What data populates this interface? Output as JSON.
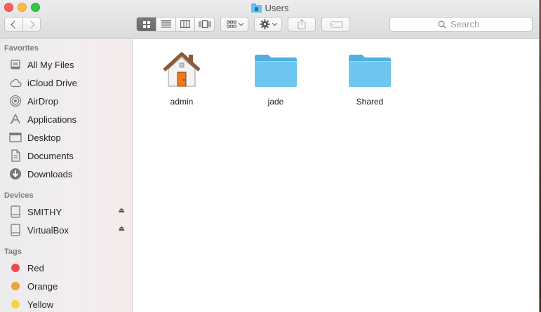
{
  "window": {
    "title": "Users",
    "title_icon": "users-folder-icon"
  },
  "toolbar": {
    "back_icon": "chevron-left-icon",
    "forward_icon": "chevron-right-icon",
    "view_modes": [
      "icon-view",
      "list-view",
      "column-view",
      "cover-flow-view"
    ],
    "active_view": "icon-view",
    "arrange_icon": "arrange-grid-icon",
    "action_icon": "gear-icon",
    "share_icon": "share-icon",
    "tag_icon": "tag-icon",
    "search_placeholder": "Search"
  },
  "sidebar": {
    "favorites": {
      "header": "Favorites",
      "items": [
        {
          "label": "All My Files",
          "icon": "all-files-icon"
        },
        {
          "label": "iCloud Drive",
          "icon": "cloud-icon"
        },
        {
          "label": "AirDrop",
          "icon": "airdrop-icon"
        },
        {
          "label": "Applications",
          "icon": "applications-icon"
        },
        {
          "label": "Desktop",
          "icon": "desktop-icon"
        },
        {
          "label": "Documents",
          "icon": "documents-icon"
        },
        {
          "label": "Downloads",
          "icon": "downloads-icon"
        }
      ]
    },
    "devices": {
      "header": "Devices",
      "items": [
        {
          "label": "SMITHY",
          "icon": "disk-icon",
          "ejectable": true
        },
        {
          "label": "VirtualBox",
          "icon": "disk-icon",
          "ejectable": true
        }
      ]
    },
    "tags": {
      "header": "Tags",
      "items": [
        {
          "label": "Red",
          "color": "#f2484d"
        },
        {
          "label": "Orange",
          "color": "#f3a03c"
        },
        {
          "label": "Yellow",
          "color": "#f5d349"
        }
      ]
    }
  },
  "content": {
    "items": [
      {
        "name": "admin",
        "icon": "home-folder-icon"
      },
      {
        "name": "jade",
        "icon": "folder-icon"
      },
      {
        "name": "Shared",
        "icon": "folder-icon"
      }
    ],
    "folder_color": "#6ec6f0"
  }
}
